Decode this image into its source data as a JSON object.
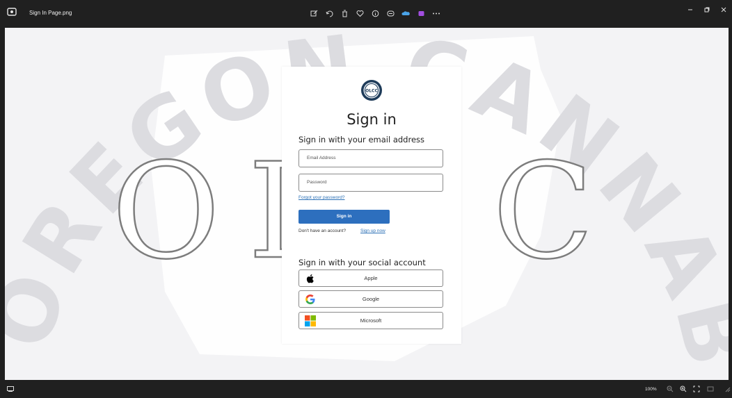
{
  "window": {
    "file_name": "Sign In Page.png",
    "toolbar_icons": [
      "edit-image-icon",
      "rotate-icon",
      "delete-icon",
      "favorite-icon",
      "info-icon",
      "copilot-icon",
      "onedrive-icon",
      "clipchamp-icon",
      "more-icon"
    ],
    "controls": [
      "minimize-icon",
      "restore-icon",
      "close-icon"
    ]
  },
  "background": {
    "arc_text": "OREGON CANNABIS",
    "center_text": "OLCC"
  },
  "signin": {
    "logo_text": "OLCC",
    "title": "Sign in",
    "email_heading": "Sign in with your email address",
    "email_placeholder": "Email Address",
    "password_placeholder": "Password",
    "forgot_link": "Forgot your password?",
    "signin_button": "Sign in",
    "no_account_text": "Don't have an account?",
    "signup_link": "Sign up now",
    "social_heading": "Sign in with your social account",
    "social_buttons": [
      {
        "label": "Apple",
        "icon": "apple-icon"
      },
      {
        "label": "Google",
        "icon": "google-icon"
      },
      {
        "label": "Microsoft",
        "icon": "microsoft-icon"
      }
    ]
  },
  "statusbar": {
    "zoom": "100%"
  },
  "colors": {
    "accent": "#2d6fbe",
    "link": "#2a6fb5",
    "watermark": "#dedee2"
  }
}
